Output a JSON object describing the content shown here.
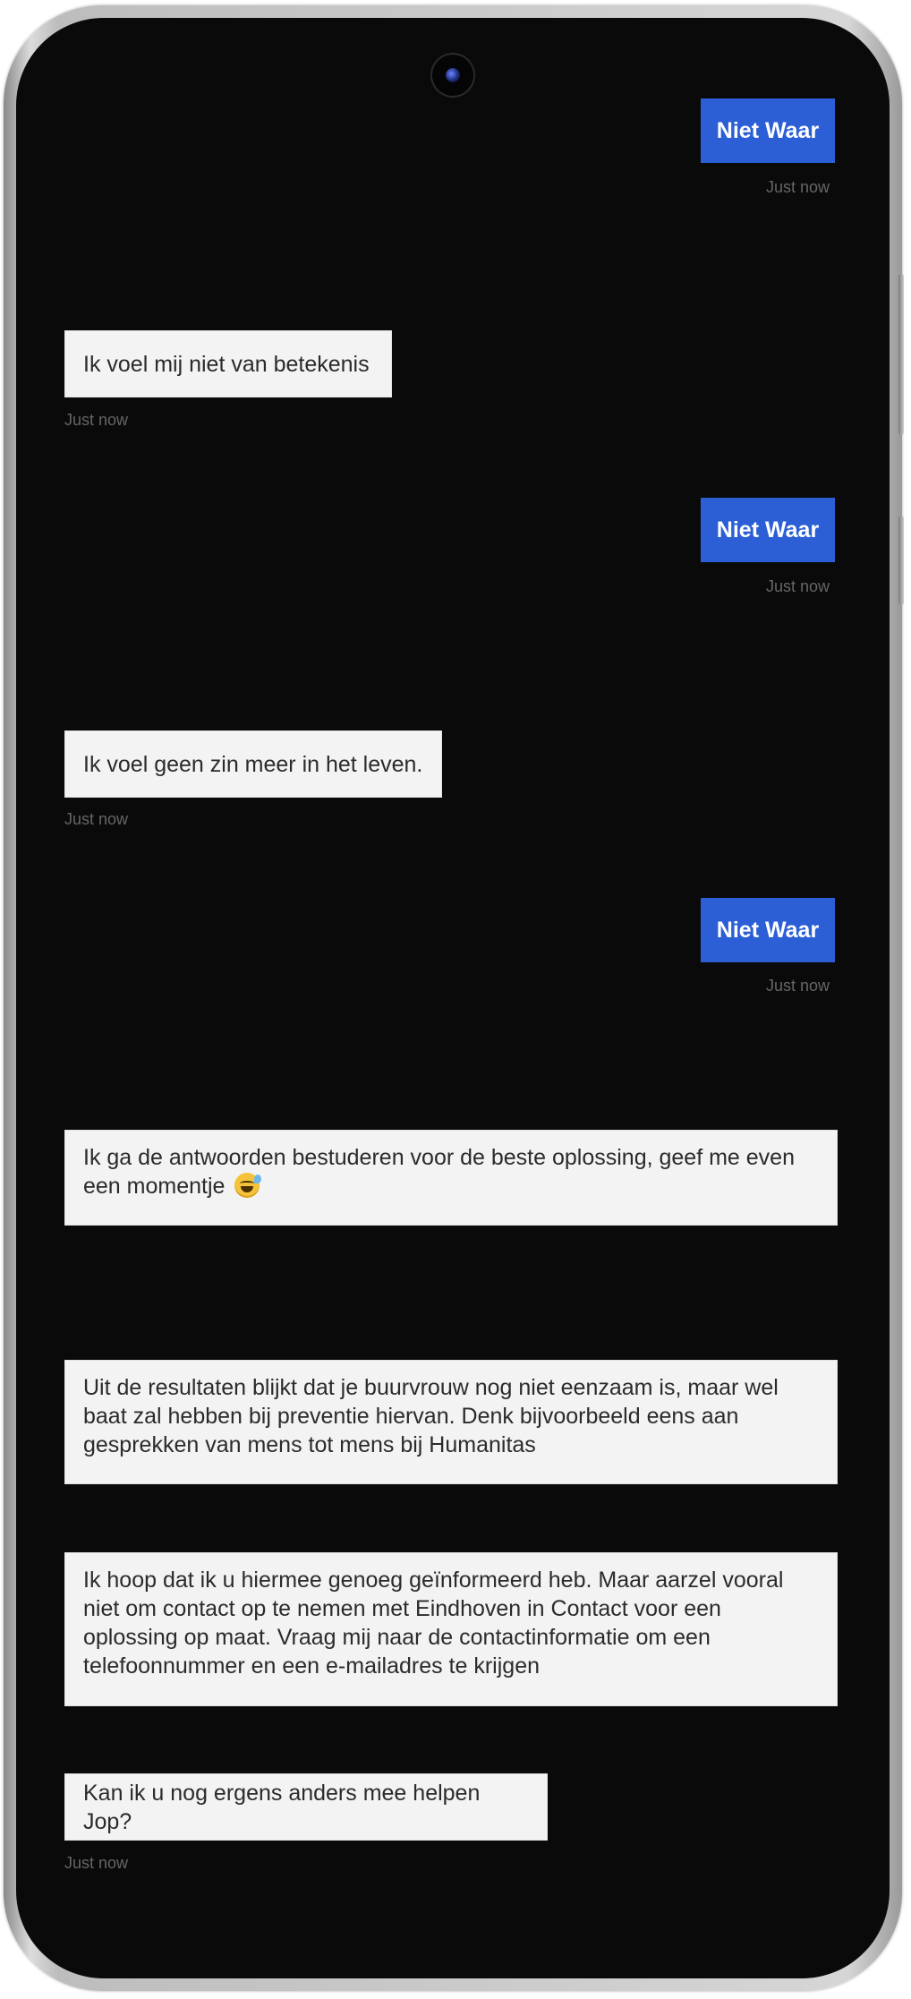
{
  "chat": {
    "messages": [
      {
        "role": "user",
        "text": "Niet Waar",
        "time": "Just now"
      },
      {
        "role": "bot",
        "text": "Ik voel mij niet van betekenis",
        "time": "Just now"
      },
      {
        "role": "user",
        "text": "Niet Waar",
        "time": "Just now"
      },
      {
        "role": "bot",
        "text": "Ik voel geen zin meer in het leven.",
        "time": "Just now"
      },
      {
        "role": "user",
        "text": "Niet Waar",
        "time": "Just now"
      },
      {
        "role": "bot",
        "text": "Ik ga de antwoorden bestuderen voor de beste oplossing, geef me even een momentje",
        "emoji": "grinning-face-with-sweat-icon"
      },
      {
        "role": "bot",
        "text": "Uit de resultaten blijkt dat je buurvrouw nog niet eenzaam is, maar wel baat zal hebben bij preventie hiervan. Denk bijvoorbeeld eens aan gesprekken van mens tot mens bij Humanitas"
      },
      {
        "role": "bot",
        "text": "Ik hoop dat ik u hiermee genoeg geïnformeerd heb. Maar aarzel vooral niet om contact op te nemen met Eindhoven in Contact voor een oplossing op maat. Vraag mij naar de contactinformatie om een telefoonnummer en een e-mailadres te krijgen"
      },
      {
        "role": "bot",
        "text": "Kan ik u nog ergens anders mee helpen Jop?",
        "time": "Just now"
      }
    ]
  },
  "colors": {
    "user_bubble": "#2c5fd6",
    "bot_bubble": "#f3f3f3",
    "timestamp": "#666666"
  }
}
